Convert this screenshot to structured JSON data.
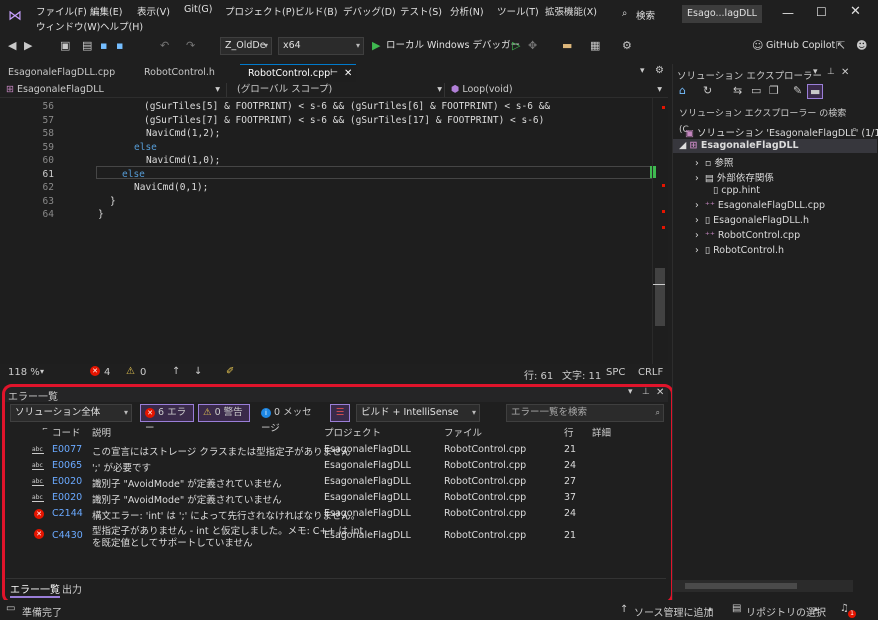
{
  "menu": {
    "row1": [
      "ファイル(F)",
      "編集(E)",
      "表示(V)",
      "Git(G)",
      "プロジェクト(P)",
      "ビルド(B)",
      "デバッグ(D)",
      "テスト(S)",
      "分析(N)",
      "ツール(T)",
      "拡張機能(X)"
    ],
    "row2": [
      "ウィンドウ(W)",
      "ヘルプ(H)"
    ],
    "search": "検索",
    "title_tab": "Esago...lagDLL"
  },
  "toolbar": {
    "config": "Z_OldDe",
    "platform": "x64",
    "run_label": "ローカル Windows デバッガー",
    "copilot": "GitHub Copilot"
  },
  "tabs": [
    "EsagonaleFlagDLL.cpp",
    "RobotControl.h",
    "RobotControl.cpp"
  ],
  "navbar": {
    "project": "EsagonaleFlagDLL",
    "scope": "(グローバル スコープ)",
    "function": "Loop(void)"
  },
  "editor": {
    "lines": [
      {
        "n": "56",
        "text": "(gSurTiles[5] & FOOTPRINT) < s-6 && (gSurTiles[6] & FOOTPRINT) < s-6 &&"
      },
      {
        "n": "57",
        "text": "(gSurTiles[7] & FOOTPRINT) < s-6 && (gSurTiles[17] & FOOTPRINT) < s-6)"
      },
      {
        "n": "58",
        "text": "NaviCmd(1,2);"
      },
      {
        "n": "59",
        "text": "else"
      },
      {
        "n": "60",
        "text": "NaviCmd(1,0);"
      },
      {
        "n": "61",
        "text": "else"
      },
      {
        "n": "62",
        "text": "NaviCmd(0,1);"
      },
      {
        "n": "63",
        "text": "}"
      },
      {
        "n": "64",
        "text": "}"
      }
    ]
  },
  "statusline": {
    "zoom": "118 %",
    "errors": "4",
    "warnings": "0",
    "line": "行: 61",
    "col": "文字: 11",
    "spc": "SPC",
    "eol": "CRLF"
  },
  "errorlist": {
    "title": "エラー一覧",
    "scope": "ソリューション全体",
    "errors_btn": "6 エラー",
    "warnings_btn": "0 警告",
    "messages_btn": "0 メッセージ",
    "build_filter": "ビルド + IntelliSense",
    "search_placeholder": "エラー一覧を検索",
    "columns": [
      "コード",
      "説明",
      "プロジェクト",
      "ファイル",
      "行",
      "詳細"
    ],
    "rows": [
      {
        "icon": "abs",
        "code": "E0077",
        "desc": "この宣言にはストレージ クラスまたは型指定子がありません",
        "project": "EsagonaleFlagDLL",
        "file": "RobotControl.cpp",
        "line": "21"
      },
      {
        "icon": "abs",
        "code": "E0065",
        "desc": "';' が必要です",
        "project": "EsagonaleFlagDLL",
        "file": "RobotControl.cpp",
        "line": "24"
      },
      {
        "icon": "abs",
        "code": "E0020",
        "desc": "識別子 \"AvoidMode\" が定義されていません",
        "project": "EsagonaleFlagDLL",
        "file": "RobotControl.cpp",
        "line": "27"
      },
      {
        "icon": "abs",
        "code": "E0020",
        "desc": "識別子 \"AvoidMode\" が定義されていません",
        "project": "EsagonaleFlagDLL",
        "file": "RobotControl.cpp",
        "line": "37"
      },
      {
        "icon": "err",
        "code": "C2144",
        "desc": "構文エラー: 'int' は ';' によって先行されなければなりません。",
        "project": "EsagonaleFlagDLL",
        "file": "RobotControl.cpp",
        "line": "24"
      },
      {
        "icon": "err",
        "code": "C4430",
        "desc": "型指定子がありません - int と仮定しました。メモ: C++ は int",
        "desc2": "を既定値としてサポートしていません",
        "project": "EsagonaleFlagDLL",
        "file": "RobotControl.cpp",
        "line": "21"
      }
    ],
    "bottom_tabs": [
      "エラー一覧",
      "出力"
    ]
  },
  "solution_explorer": {
    "title": "ソリューション エクスプローラー",
    "search": "ソリューション エクスプローラー の検索 (C",
    "solution": "ソリューション 'EsagonaleFlagDLL' (1/1",
    "project": "EsagonaleFlagDLL",
    "items": [
      "参照",
      "外部依存関係",
      "cpp.hint",
      "EsagonaleFlagDLL.cpp",
      "EsagonaleFlagDLL.h",
      "RobotControl.cpp",
      "RobotControl.h"
    ]
  },
  "statusbar": {
    "ready": "準備完了",
    "add_source": "ソース管理に追加",
    "repo": "リポジトリの選択"
  },
  "colors": {
    "accent": "#e0142b",
    "error": "#e51400",
    "keyword": "#569cd6"
  }
}
